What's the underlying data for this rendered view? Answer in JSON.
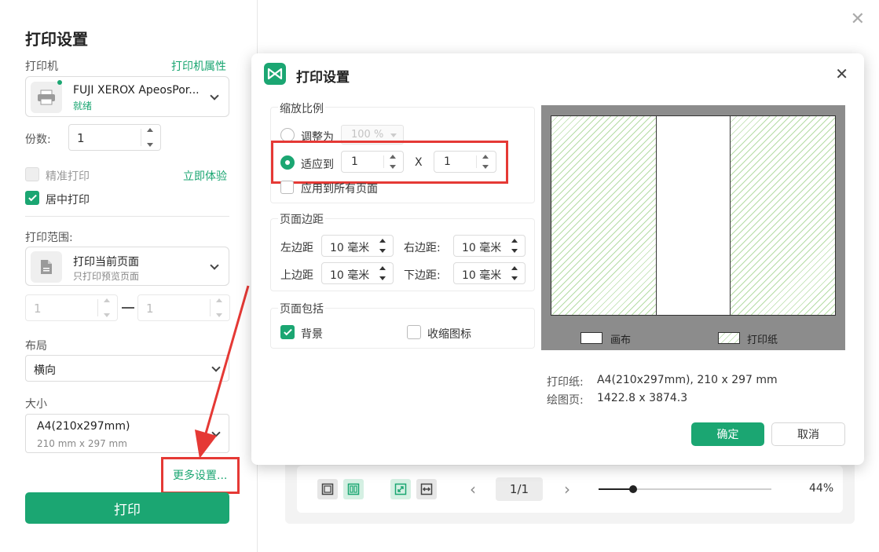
{
  "left": {
    "title": "打印设置",
    "printer_label": "打印机",
    "printer_props_link": "打印机属性",
    "printer_name": "FUJI XEROX ApeosPor...",
    "printer_status": "就绪",
    "copies_label": "份数:",
    "copies_value": "1",
    "precise_print_label": "精准打印",
    "try_now_link": "立即体验",
    "center_print_label": "居中打印",
    "range_label": "打印范围:",
    "range_title": "打印当前页面",
    "range_subtitle": "只打印预览页面",
    "range_from": "1",
    "range_to": "1",
    "layout_label": "布局",
    "layout_value": "横向",
    "size_label": "大小",
    "size_title": "A4(210x297mm)",
    "size_subtitle": "210 mm x 297 mm",
    "more_settings": "更多设置...",
    "print_button": "打印"
  },
  "toolbar": {
    "page_indicator": "1/1",
    "zoom": "44%",
    "zoom_fraction": 0.2
  },
  "dialog": {
    "title": "打印设置",
    "scale_section": "缩放比例",
    "adjust_to_label": "调整为",
    "adjust_to_value": "100 %",
    "fit_to_label": "适应到",
    "fit_x": "1",
    "fit_times": "X",
    "fit_y": "1",
    "apply_all_pages": "应用到所有页面",
    "margin_section": "页面边距",
    "left_margin_label": "左边距",
    "left_margin_value": "10 毫米",
    "right_margin_label": "右边距:",
    "right_margin_value": "10 毫米",
    "top_margin_label": "上边距",
    "top_margin_value": "10 毫米",
    "bottom_margin_label": "下边距:",
    "bottom_margin_value": "10 毫米",
    "include_section": "页面包括",
    "background_label": "背景",
    "collapse_icons_label": "收缩图标",
    "legend_canvas": "画布",
    "legend_paper": "打印纸",
    "paper_info_label": "打印纸:",
    "paper_info_value": "A4(210x297mm), 210 x 297 mm",
    "drawing_page_label": "绘图页:",
    "drawing_page_value": "1422.8 x 3874.3",
    "ok_button": "确定",
    "cancel_button": "取消"
  },
  "colors": {
    "accent": "#1ba672",
    "highlight": "#e53935"
  }
}
